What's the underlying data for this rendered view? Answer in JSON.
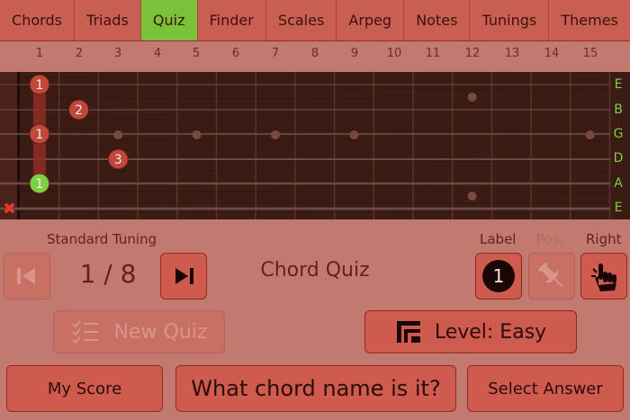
{
  "menu": {
    "items": [
      {
        "label": "Chords"
      },
      {
        "label": "Triads"
      },
      {
        "label": "Quiz",
        "active": true
      },
      {
        "label": "Finder"
      },
      {
        "label": "Scales"
      },
      {
        "label": "Arpeg"
      },
      {
        "label": "Notes"
      },
      {
        "label": "Tunings"
      },
      {
        "label": "Themes"
      }
    ]
  },
  "fret_numbers": [
    "1",
    "2",
    "3",
    "4",
    "5",
    "6",
    "7",
    "8",
    "9",
    "10",
    "11",
    "12",
    "13",
    "14",
    "15"
  ],
  "fretboard": {
    "strings": [
      "E",
      "B",
      "G",
      "D",
      "A",
      "E"
    ],
    "inlay_frets": [
      3,
      5,
      7,
      9,
      12,
      15
    ],
    "barre_fret": 1,
    "markers": [
      {
        "label": "1",
        "string": "E",
        "fret": 1,
        "color": "red"
      },
      {
        "label": "2",
        "string": "B",
        "fret": 2,
        "color": "red"
      },
      {
        "label": "1",
        "string": "G",
        "fret": 1,
        "color": "red"
      },
      {
        "label": "3",
        "string": "D",
        "fret": 3,
        "color": "red"
      },
      {
        "label": "1",
        "string": "A",
        "fret": 1,
        "color": "green"
      }
    ],
    "muted_string": "E",
    "mute_symbol": "✖"
  },
  "tuning_label": "Standard Tuning",
  "counter": "1 / 8",
  "quiz_title": "Chord Quiz",
  "options": {
    "label_header": "Label",
    "pos_header": "Pos.",
    "right_header": "Right",
    "label_value": "1"
  },
  "buttons": {
    "new_quiz": "New Quiz",
    "level": "Level: Easy",
    "my_score": "My Score",
    "question": "What chord name is it?",
    "select_answer": "Select Answer"
  },
  "colors": {
    "accent_active": "#79c23a",
    "marker_red": "#c0483a",
    "marker_green": "#7ed040",
    "fretboard_wood": "#3a1c15",
    "button_fill": "#cf5a4e"
  }
}
